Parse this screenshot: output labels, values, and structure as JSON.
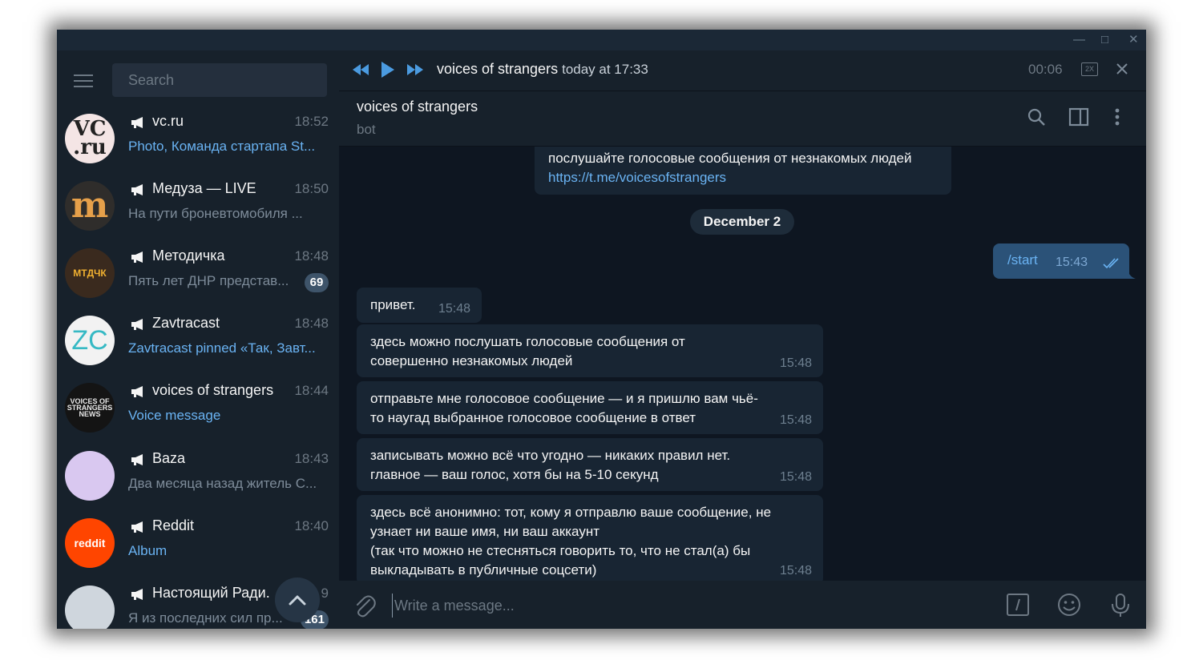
{
  "window": {
    "controls": {
      "minimize": "—",
      "maximize": "□",
      "close": "✕"
    }
  },
  "sidebar": {
    "search_placeholder": "Search",
    "chats": [
      {
        "name": "vc.ru",
        "time": "18:52",
        "preview": "Photo, Команда стартапа St...",
        "avatar_text": "VC\n.ru",
        "avatar_bg": "#f4e5e5",
        "preview_accent": true
      },
      {
        "name": "Медуза — LIVE",
        "time": "18:50",
        "preview": "На пути броневтомобиля ...",
        "avatar_text": "m",
        "avatar_bg": "#2f2d2b",
        "preview_accent": false
      },
      {
        "name": "Методичка",
        "time": "18:48",
        "preview": "Пять лет ДНР представ...",
        "avatar_text": "MTДЧК",
        "avatar_bg": "#3a2a1e",
        "badge": "69",
        "preview_accent": false
      },
      {
        "name": "Zavtracast",
        "time": "18:48",
        "preview": "Zavtracast pinned «Так, Завт...",
        "avatar_text": "ZC",
        "avatar_bg": "#f2f2f2",
        "preview_accent": true
      },
      {
        "name": "voices of strangers",
        "time": "18:44",
        "preview": "Voice message",
        "avatar_text": "VOICES OF STRANGERS NEWS",
        "avatar_bg": "#141414",
        "preview_accent": true
      },
      {
        "name": "Baza",
        "time": "18:43",
        "preview": "Два месяца назад житель С...",
        "avatar_text": "",
        "avatar_bg": "#d9c8f0",
        "preview_accent": false
      },
      {
        "name": "Reddit",
        "time": "18:40",
        "preview": "Album",
        "avatar_text": "reddit",
        "avatar_bg": "#ff4500",
        "preview_accent": true
      },
      {
        "name": "Настоящий Ради.",
        "time": "9",
        "preview": "Я из последних сил пр...",
        "avatar_text": "",
        "avatar_bg": "#cfd6dd",
        "badge": "161",
        "preview_accent": false
      }
    ]
  },
  "player": {
    "title": "voices of strangers",
    "subtitle": "today at 17:33",
    "time": "00:06",
    "speed": "2X"
  },
  "header": {
    "title": "voices of strangers",
    "status": "bot"
  },
  "messages": {
    "intro": {
      "text": "послушайте голосовые сообщения от незнакомых людей",
      "link": "https://t.me/voicesofstrangers"
    },
    "date": "December 2",
    "outgoing": {
      "text": "/start",
      "time": "15:43"
    },
    "incoming": [
      {
        "text": "привет.",
        "time": "15:48"
      },
      {
        "text": "здесь можно послушать голосовые сообщения от\nсовершенно незнакомых людей",
        "time": "15:48"
      },
      {
        "text": "отправьте мне голосовое сообщение — и я пришлю вам чьё-\nто наугад выбранное голосовое сообщение в ответ",
        "time": "15:48"
      },
      {
        "text": "записывать можно всё что угодно — никаких правил нет.\nглавное — ваш голос, хотя бы на 5-10 секунд",
        "time": "15:48"
      },
      {
        "text": "здесь всё анонимно: тот, кому я отправлю ваше сообщение, не\nузнает ни ваше имя, ни ваш аккаунт\n(так что можно не стесняться говорить то, что не стал(а) бы\nвыкладывать в публичные соцсети)",
        "time": "15:48"
      }
    ]
  },
  "composer": {
    "placeholder": "Write a message..."
  },
  "colors": {
    "accent": "#6ab3f3",
    "sidebar_bg": "#17212b",
    "chat_bg": "#0e1621",
    "bubble_in": "#182533",
    "bubble_out": "#2b5278"
  }
}
